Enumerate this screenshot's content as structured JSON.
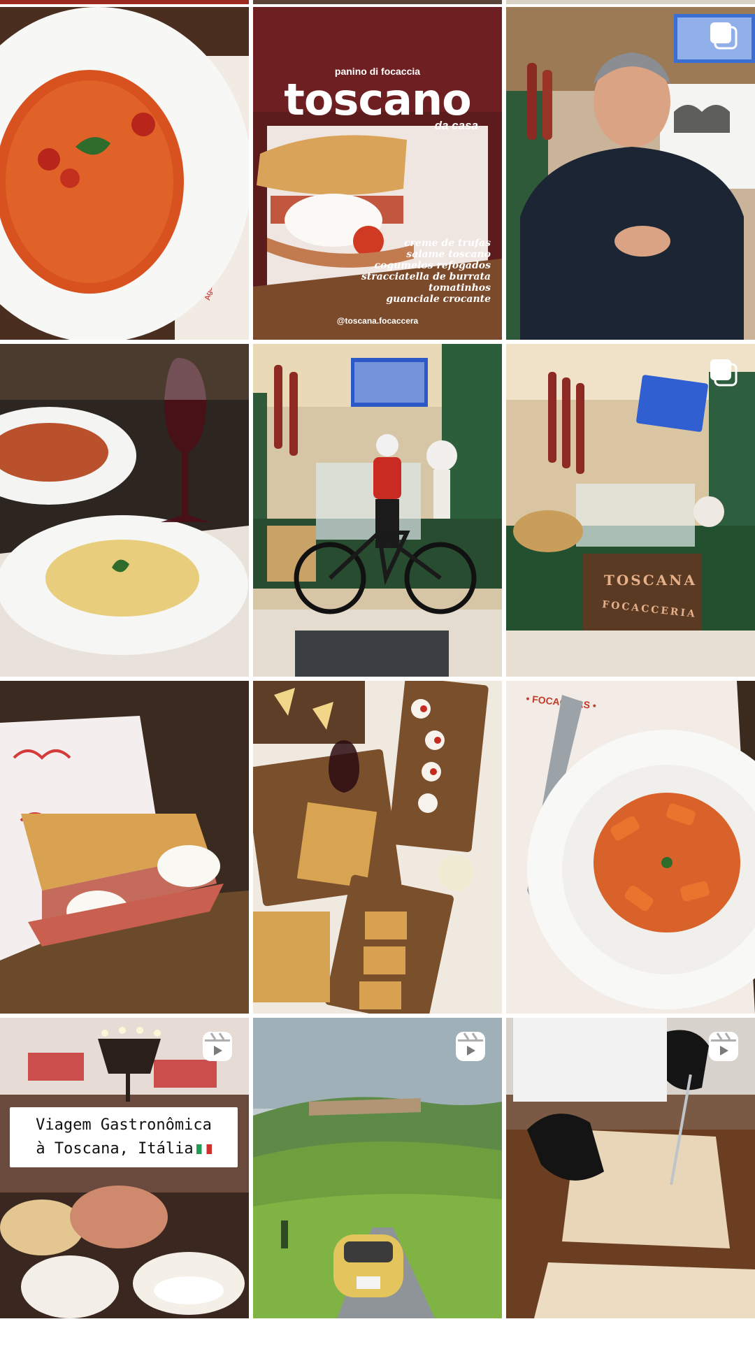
{
  "tiles": [
    {
      "id": "risotto-post",
      "type": "photo",
      "subject": "tomato risotto with basil in white bowl"
    },
    {
      "id": "toscano-post",
      "type": "photo",
      "subject": "focaccia sandwich advertisement",
      "overlay": {
        "kicker": "panino di focaccia",
        "title": "toscano",
        "subtitle": "da casa",
        "ingredients": [
          "creme de trufas",
          "salame toscano",
          "cogumelos refogados",
          "stracciatella de burrata",
          "tomatinhos",
          "guanciale crocante"
        ],
        "handle": "@toscana.focaccera"
      }
    },
    {
      "id": "owner-video-post",
      "type": "carousel",
      "subject": "man speaking in deli"
    },
    {
      "id": "pasta-wine-post",
      "type": "photo",
      "subject": "two pasta dishes and red wine"
    },
    {
      "id": "cyclist-post",
      "type": "photo",
      "subject": "cyclist with bike inside focacceria"
    },
    {
      "id": "counter-post",
      "type": "carousel",
      "subject": "Toscana Focacceria counter",
      "overlay": {
        "sign_line1": "TOSCANA",
        "sign_line2": "FOCACCERIA"
      }
    },
    {
      "id": "focaccia-sandwich-post",
      "type": "photo",
      "subject": "focaccia sandwich with mozzarella and ham"
    },
    {
      "id": "tasting-board-post",
      "type": "photo",
      "subject": "table spread with bruschetta, cheese, wine"
    },
    {
      "id": "rigatoni-post",
      "type": "photo",
      "subject": "rigatoni with tomato sauce and parmesan"
    },
    {
      "id": "viagem-reel",
      "type": "reel",
      "subject": "restaurant interior with sandwiches",
      "overlay": {
        "caption_line1": "Viagem Gastronômica",
        "caption_line2": "à Toscana, Itália"
      }
    },
    {
      "id": "tuscany-reel",
      "type": "reel",
      "subject": "yellow Fiat 500 on Tuscan road"
    },
    {
      "id": "cutting-reel",
      "type": "reel",
      "subject": "chef cutting focaccia with gloved hands"
    }
  ],
  "icons": {
    "carousel": "carousel-icon",
    "reel": "reel-icon"
  },
  "colors": {
    "background": "#ffffff",
    "icon": "#ffffff"
  }
}
